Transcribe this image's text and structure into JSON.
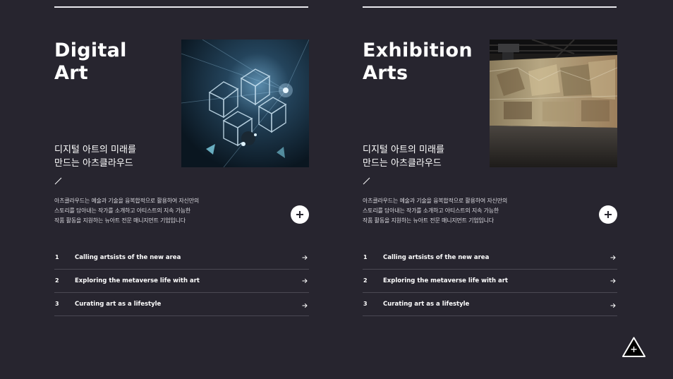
{
  "cards": [
    {
      "title_line1": "Digital",
      "title_line2": "Art",
      "subtitle_line1": "디지털 아트의 미래를",
      "subtitle_line2": "만드는 아츠클라우드",
      "desc_line1": "아츠클라우드는 예술과 기술을 융복합적으로 활용하여 자신만의",
      "desc_line2": "스토리를 담아내는 작가를 소개하고 아티스트의 지속 가능한",
      "desc_line3": "작품 활동을 지원하는 뉴아트 전문 매니지먼트 기업입니다",
      "items": [
        {
          "num": "1",
          "label": "Calling artsists of the new area"
        },
        {
          "num": "2",
          "label": "Exploring the metaverse life with art"
        },
        {
          "num": "3",
          "label": "Curating art as a lifestyle"
        }
      ]
    },
    {
      "title_line1": "Exhibition",
      "title_line2": "Arts",
      "subtitle_line1": "디지털 아트의 미래를",
      "subtitle_line2": "만드는 아츠클라우드",
      "desc_line1": "아츠클라우드는 예술과 기술을 융복합적으로 활용하여 자신만의",
      "desc_line2": "스토리를 담아내는 작가를 소개하고 아티스트의 지속 가능한",
      "desc_line3": "작품 활동을 지원하는 뉴아트 전문 매니지먼트 기업입니다",
      "items": [
        {
          "num": "1",
          "label": "Calling artsists of the new area"
        },
        {
          "num": "2",
          "label": "Exploring the metaverse life with art"
        },
        {
          "num": "3",
          "label": "Curating art as a lifestyle"
        }
      ]
    }
  ],
  "colors": {
    "background": "#27252f",
    "text": "#ffffff",
    "divider": "#4a4853"
  },
  "icons": {
    "plus": "plus-icon",
    "arrow": "arrow-right-icon",
    "scroll_top": "triangle-plus-icon",
    "slash": "slash-icon"
  }
}
